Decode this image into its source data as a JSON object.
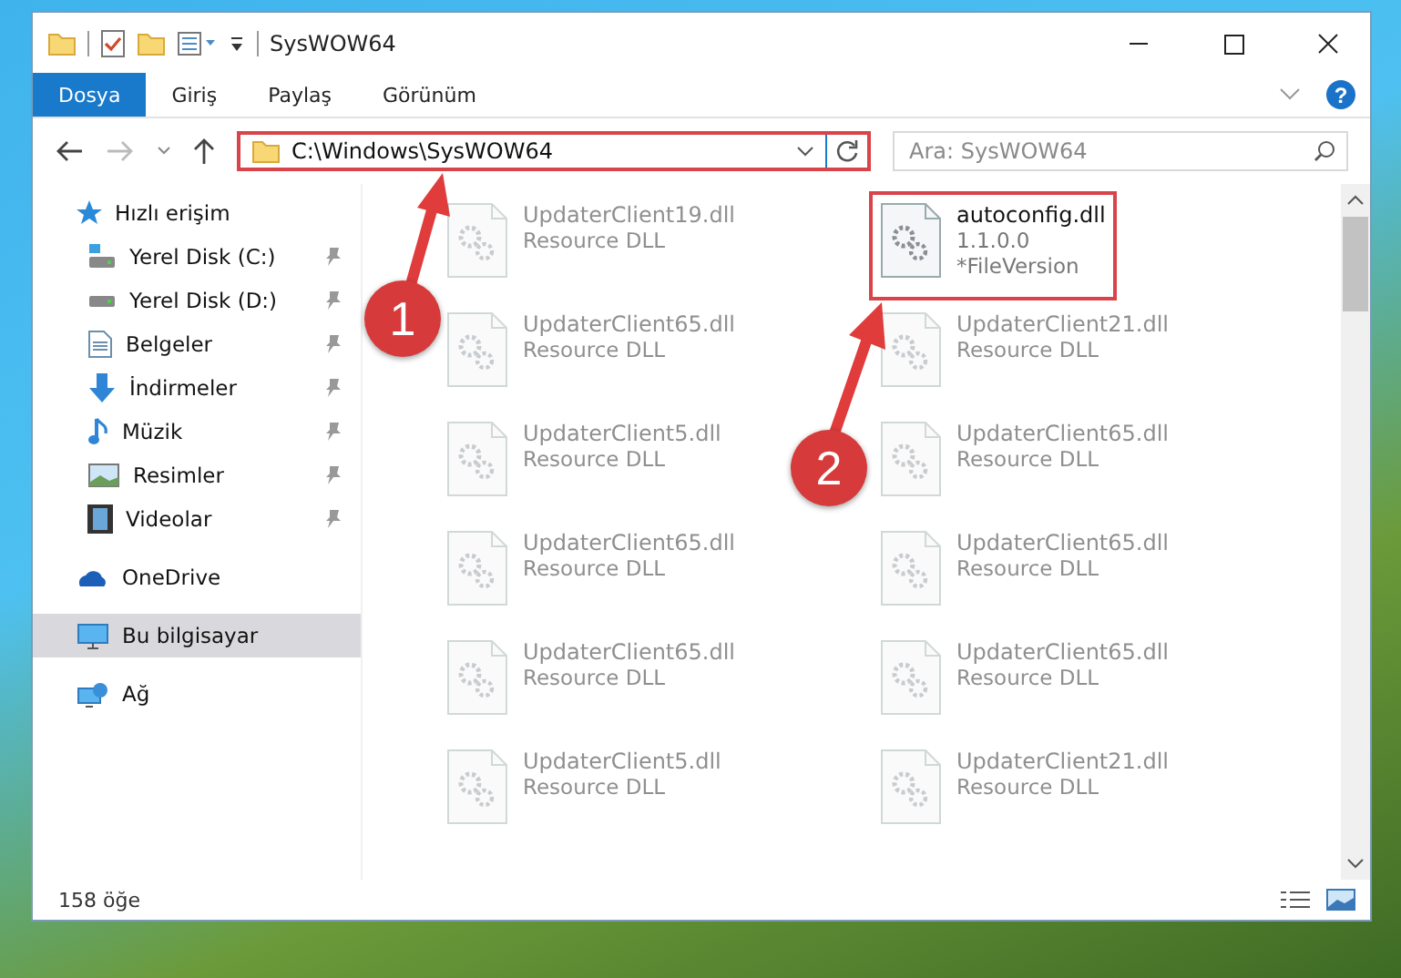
{
  "window": {
    "title": "SysWOW64"
  },
  "ribbon_tabs": [
    {
      "label": "Dosya",
      "selected": true
    },
    {
      "label": "Giriş",
      "selected": false
    },
    {
      "label": "Paylaş",
      "selected": false
    },
    {
      "label": "Görünüm",
      "selected": false
    }
  ],
  "address": {
    "path": "C:\\Windows\\SysWOW64",
    "highlighted": true
  },
  "help": {
    "glyph": "?"
  },
  "search": {
    "placeholder": "Ara: SysWOW64"
  },
  "sidebar": {
    "items": [
      {
        "label": "Hızlı erişim",
        "kind": "star",
        "selected": false,
        "children": [
          {
            "label": "Yerel Disk (C:)",
            "kind": "disk-c",
            "pinned": true
          },
          {
            "label": "Yerel Disk (D:)",
            "kind": "disk",
            "pinned": true
          },
          {
            "label": "Belgeler",
            "kind": "docs",
            "pinned": true
          },
          {
            "label": "İndirmeler",
            "kind": "download",
            "pinned": true
          },
          {
            "label": "Müzik",
            "kind": "music",
            "pinned": true
          },
          {
            "label": "Resimler",
            "kind": "pictures",
            "pinned": true
          },
          {
            "label": "Videolar",
            "kind": "videos",
            "pinned": true
          }
        ]
      },
      {
        "label": "OneDrive",
        "kind": "cloud",
        "selected": false
      },
      {
        "label": "Bu bilgisayar",
        "kind": "pc",
        "selected": true
      },
      {
        "label": "Ağ",
        "kind": "network",
        "selected": false
      }
    ]
  },
  "files": [
    {
      "name": "UpdaterClient19.dll",
      "lines": [
        "Resource DLL"
      ],
      "blurred": true,
      "highlighted": false
    },
    {
      "name": "autoconfig.dll",
      "lines": [
        "1.1.0.0",
        "*FileVersion"
      ],
      "blurred": false,
      "highlighted": true
    },
    {
      "name": "UpdaterClient65.dll",
      "lines": [
        "Resource DLL"
      ],
      "blurred": true,
      "highlighted": false
    },
    {
      "name": "UpdaterClient21.dll",
      "lines": [
        "Resource DLL"
      ],
      "blurred": true,
      "highlighted": false
    },
    {
      "name": "UpdaterClient5.dll",
      "lines": [
        "Resource DLL"
      ],
      "blurred": true,
      "highlighted": false
    },
    {
      "name": "UpdaterClient65.dll",
      "lines": [
        "Resource DLL"
      ],
      "blurred": true,
      "highlighted": false
    },
    {
      "name": "UpdaterClient65.dll",
      "lines": [
        "Resource DLL"
      ],
      "blurred": true,
      "highlighted": false
    },
    {
      "name": "UpdaterClient65.dll",
      "lines": [
        "Resource DLL"
      ],
      "blurred": true,
      "highlighted": false
    },
    {
      "name": "UpdaterClient65.dll",
      "lines": [
        "Resource DLL"
      ],
      "blurred": true,
      "highlighted": false
    },
    {
      "name": "UpdaterClient65.dll",
      "lines": [
        "Resource DLL"
      ],
      "blurred": true,
      "highlighted": false
    },
    {
      "name": "UpdaterClient5.dll",
      "lines": [
        "Resource DLL"
      ],
      "blurred": true,
      "highlighted": false
    },
    {
      "name": "UpdaterClient21.dll",
      "lines": [
        "Resource DLL"
      ],
      "blurred": true,
      "highlighted": false
    }
  ],
  "status_bar": {
    "count": "158 öğe"
  },
  "annotations": [
    {
      "number": "1"
    },
    {
      "number": "2"
    }
  ]
}
